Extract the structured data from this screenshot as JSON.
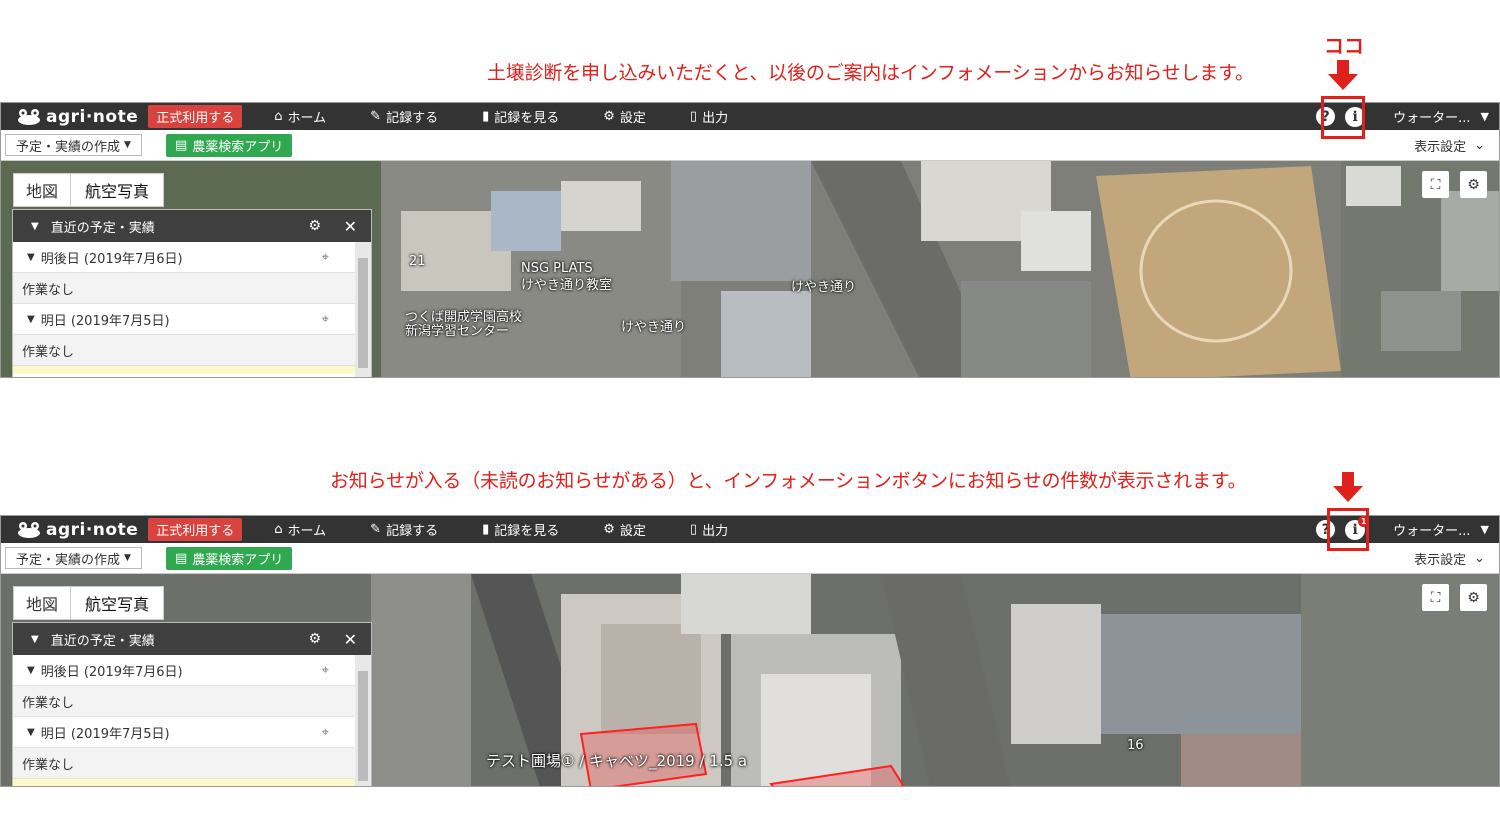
{
  "captions": {
    "top": "土壌診断を申し込みいただくと、以後のご案内はインフォメーションからお知らせします。",
    "koko": "ココ",
    "bottom": "お知らせが入る（未読のお知らせがある）と、インフォメーションボタンにお知らせの件数が表示されます。"
  },
  "colors": {
    "accent_red": "#e0201a",
    "topbar": "#333333",
    "badge": "#d9433f",
    "green_button": "#2fa84f"
  },
  "app": {
    "logo": "agri·note",
    "badge": "正式利用する",
    "nav": [
      {
        "label": "ホーム",
        "icon": "home-icon"
      },
      {
        "label": "記録する",
        "icon": "pencil-icon"
      },
      {
        "label": "記録を見る",
        "icon": "book-icon"
      },
      {
        "label": "設定",
        "icon": "gear-icon"
      },
      {
        "label": "出力",
        "icon": "document-icon"
      }
    ],
    "help": "?",
    "info": "i",
    "notification_count": "1",
    "user": "ウォーター...",
    "plan_button": "予定・実績の作成",
    "pesticide_button": "農薬検索アプリ",
    "display_setting": "表示設定",
    "map_tabs": [
      "地図",
      "航空写真"
    ],
    "recent": {
      "title": "直近の予定・実績",
      "days": [
        {
          "label": "明後日 (2019年7月6日)",
          "note": "作業なし"
        },
        {
          "label": "明日 (2019年7月5日)",
          "note": "作業なし"
        }
      ]
    }
  },
  "map1": {
    "labels": [
      "NSG PLATS",
      "けやき通り教室",
      "つくば開成学園高校",
      "新潟学習センター",
      "けやき通り",
      "けやき通り",
      "21"
    ]
  },
  "map2": {
    "field_label": "テスト圃場① / キャベツ_2019 / 1.5 a",
    "labels": [
      "16"
    ]
  }
}
